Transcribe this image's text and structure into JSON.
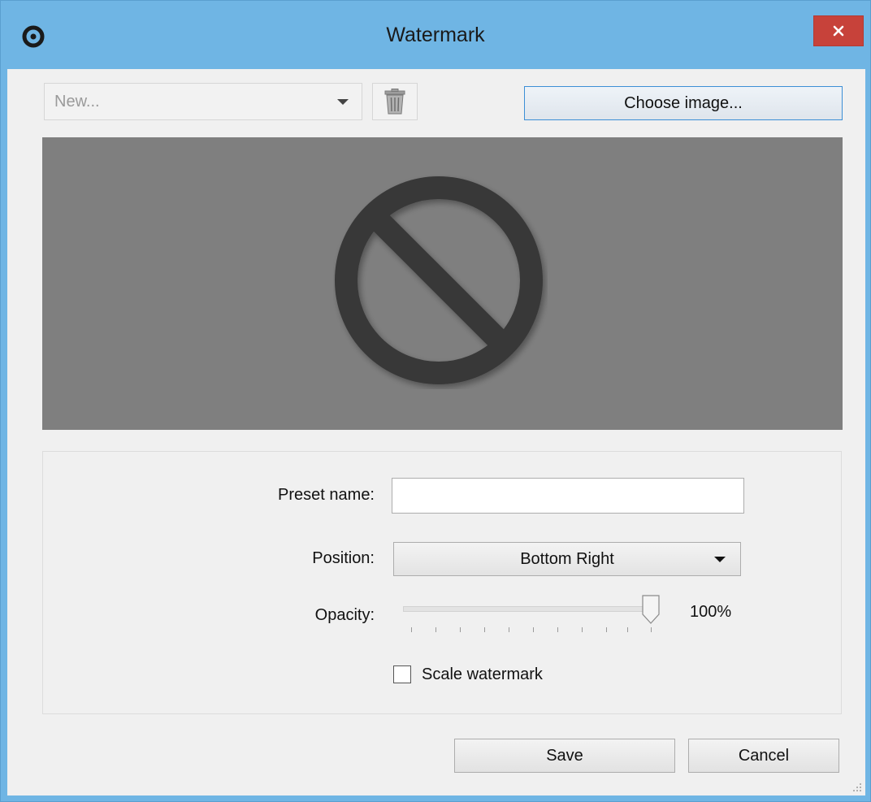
{
  "window": {
    "title": "Watermark",
    "titlebar_color": "#6fb5e4",
    "close_color": "#c7423a"
  },
  "toolbar": {
    "preset_select_value": "New...",
    "delete_icon": "trash-icon",
    "choose_image_label": "Choose image..."
  },
  "preview": {
    "background": "#7f7f7f",
    "placeholder_icon": "no-image-prohibited-icon"
  },
  "form": {
    "preset_name_label": "Preset name:",
    "preset_name_value": "",
    "position_label": "Position:",
    "position_value": "Bottom Right",
    "opacity_label": "Opacity:",
    "opacity_value_text": "100%",
    "opacity_value": 100,
    "scale_label": "Scale watermark",
    "scale_checked": false
  },
  "buttons": {
    "save_label": "Save",
    "cancel_label": "Cancel"
  }
}
